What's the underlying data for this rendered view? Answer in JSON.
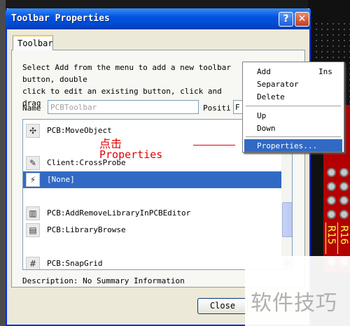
{
  "window": {
    "title": "Toolbar Properties",
    "help_glyph": "?",
    "close_glyph": "✕"
  },
  "tab": {
    "label": "Toolbar"
  },
  "instructions": {
    "line1": "Select Add from the menu to add a new toolbar",
    "line2": "button, double",
    "line3": "click to edit an existing button, click and drag"
  },
  "name_field": {
    "label": "Name",
    "placeholder": "PCBToolbar"
  },
  "position_field": {
    "label": "Positi",
    "value": "F"
  },
  "list_items": [
    {
      "icon": "move-icon",
      "glyph": "✣",
      "label": "PCB:MoveObject",
      "selected": false
    },
    {
      "icon": "crossprobe-icon",
      "glyph": "✎",
      "label": "Client:CrossProbe",
      "selected": false
    },
    {
      "icon": "lightning-icon",
      "glyph": "⚡",
      "label": "[None]",
      "selected": true
    },
    {
      "icon": "library-icon",
      "glyph": "▥",
      "label": "PCB:AddRemoveLibraryInPCBEditor",
      "selected": false
    },
    {
      "icon": "library-browse-icon",
      "glyph": "▤",
      "label": "PCB:LibraryBrowse",
      "selected": false
    },
    {
      "icon": "grid-icon",
      "glyph": "#",
      "label": "PCB:SnapGrid",
      "selected": false
    }
  ],
  "description": "Description: No Summary Information",
  "close_button": "Close",
  "annotation": {
    "line1": "点击",
    "line2": "Properties"
  },
  "context_menu": [
    {
      "label": "Add",
      "shortcut": "Ins"
    },
    {
      "label": "Separator",
      "shortcut": ""
    },
    {
      "label": "Delete",
      "shortcut": ""
    },
    {
      "label": "Up",
      "shortcut": ""
    },
    {
      "label": "Down",
      "shortcut": ""
    },
    {
      "label": "Properties...",
      "shortcut": ""
    }
  ],
  "pcb_labels": {
    "left": "R15",
    "right": "R16"
  },
  "watermark": "软件技巧",
  "colors": {
    "titlebar": "#0054e3",
    "selection": "#316ac5",
    "annotation": "#e00000",
    "pcb_red": "#b40000",
    "silkscreen": "#ffff40"
  }
}
